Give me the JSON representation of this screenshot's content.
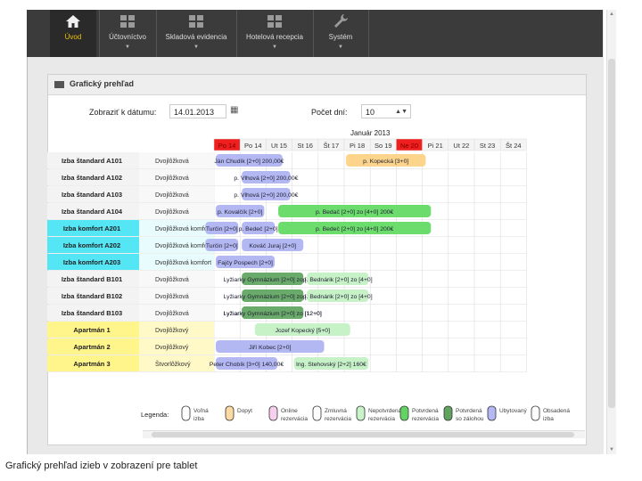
{
  "nav": {
    "items": [
      {
        "label": "Úvod",
        "icon": "home-icon",
        "active": true
      },
      {
        "label": "Účtovníctvo",
        "icon": "grid-icon",
        "active": false
      },
      {
        "label": "Skladová evidencia",
        "icon": "grid-icon",
        "active": false
      },
      {
        "label": "Hotelová recepcia",
        "icon": "grid-icon",
        "active": false
      },
      {
        "label": "Systém",
        "icon": "wrench-icon",
        "active": false
      }
    ]
  },
  "panel": {
    "title": "Grafický prehľad"
  },
  "filters": {
    "date_label": "Zobraziť k dátumu:",
    "date_value": "14.01.2013",
    "days_label": "Počet dní:",
    "days_value": "10"
  },
  "calendar": {
    "month": "Január 2013",
    "days": [
      {
        "label": "Po 14",
        "holiday": true
      },
      {
        "label": "Po 14",
        "holiday": false
      },
      {
        "label": "Ut 15",
        "holiday": false
      },
      {
        "label": "St 16",
        "holiday": false
      },
      {
        "label": "Št 17",
        "holiday": false
      },
      {
        "label": "Pi 18",
        "holiday": false
      },
      {
        "label": "So 19",
        "holiday": false
      },
      {
        "label": "Ne 20",
        "holiday": true
      },
      {
        "label": "Pi 21",
        "holiday": false
      },
      {
        "label": "Ut 22",
        "holiday": false
      },
      {
        "label": "St 23",
        "holiday": false
      },
      {
        "label": "Št 24",
        "holiday": false
      }
    ],
    "rooms": [
      {
        "name": "Izba štandard A101",
        "type": "Dvojlôžková",
        "cat": "std"
      },
      {
        "name": "Izba štandard A102",
        "type": "Dvojlôžková",
        "cat": "std"
      },
      {
        "name": "Izba štandard A103",
        "type": "Dvojlôžková",
        "cat": "std"
      },
      {
        "name": "Izba štandard A104",
        "type": "Dvojlôžková",
        "cat": "std"
      },
      {
        "name": "Izba komfort A201",
        "type": "Dvojlôžková komfort",
        "cat": "kom"
      },
      {
        "name": "Izba komfort A202",
        "type": "Dvojlôžková komfort",
        "cat": "kom"
      },
      {
        "name": "Izba komfort A203",
        "type": "Dvojlôžková komfort",
        "cat": "kom"
      },
      {
        "name": "Izba štandard B101",
        "type": "Dvojlôžková",
        "cat": "std"
      },
      {
        "name": "Izba štandard B102",
        "type": "Dvojlôžková",
        "cat": "std"
      },
      {
        "name": "Izba štandard B103",
        "type": "Dvojlôžková",
        "cat": "std"
      },
      {
        "name": "Apartmán 1",
        "type": "Dvojlôžkový",
        "cat": "apt"
      },
      {
        "name": "Apartmán 2",
        "type": "Dvojlôžkový",
        "cat": "apt"
      },
      {
        "name": "Apartmán 3",
        "type": "Štvorlôžkový",
        "cat": "apt"
      }
    ],
    "bookings": [
      {
        "row": 0,
        "start": 0.0,
        "end": 2.7,
        "status": "ubytovany",
        "label": "Ján Chudík [2+0] 200,00€"
      },
      {
        "row": 0,
        "start": 5.0,
        "end": 8.2,
        "status": "dopyt",
        "label": "p. Kopecká [3+0]"
      },
      {
        "row": 1,
        "start": 1.0,
        "end": 3.0,
        "status": "ubytovany",
        "label": "p. Vlhová [2+0] 200,00€"
      },
      {
        "row": 2,
        "start": 1.0,
        "end": 3.0,
        "status": "ubytovany",
        "label": "p. Vlhová [2+0] 200,00€"
      },
      {
        "row": 3,
        "start": 0.0,
        "end": 2.0,
        "status": "ubytovany",
        "label": "p. Kovalčík [2+0]"
      },
      {
        "row": 3,
        "start": 2.4,
        "end": 8.4,
        "status": "potvrdena",
        "label": "p. Bedač [2+0] zo [4+0] 200€"
      },
      {
        "row": 4,
        "start": -0.4,
        "end": 1.0,
        "status": "ubytovany",
        "label": "Turčin [2+0]"
      },
      {
        "row": 4,
        "start": 1.0,
        "end": 2.4,
        "status": "ubytovany",
        "label": "p. Bedeč [2+0]"
      },
      {
        "row": 4,
        "start": 2.4,
        "end": 8.4,
        "status": "potvrdena",
        "label": "p. Bedeč [2+0] zo [4+0] 200€"
      },
      {
        "row": 5,
        "start": -0.4,
        "end": 1.0,
        "status": "ubytovany",
        "label": "Turčin [2+0]"
      },
      {
        "row": 5,
        "start": 1.0,
        "end": 3.5,
        "status": "ubytovany",
        "label": "Kováč Juraj [2+0]"
      },
      {
        "row": 6,
        "start": 0.0,
        "end": 2.4,
        "status": "ubytovany",
        "label": "Fajčy Pospech [2+0]"
      },
      {
        "row": 7,
        "start": 1.0,
        "end": 3.5,
        "status": "zalohou",
        "label": "Lyžiarky Gymnázium [2+0] zo [12+0]"
      },
      {
        "row": 7,
        "start": 3.5,
        "end": 6.0,
        "status": "nepotvrdena",
        "label": "p. Bednárik [2+0] zo [4+0]"
      },
      {
        "row": 8,
        "start": 1.0,
        "end": 3.5,
        "status": "zalohou",
        "label": "Lyžiarky Gymnázium [2+0] zo [12+0]"
      },
      {
        "row": 8,
        "start": 3.5,
        "end": 6.0,
        "status": "nepotvrdena",
        "label": "p. Bednárik [2+0] zo [4+0]"
      },
      {
        "row": 9,
        "start": 1.0,
        "end": 3.5,
        "status": "zalohou",
        "label": "Lyžiarky Gymnázium [2+0] zo [12+0]"
      },
      {
        "row": 9,
        "start": 1.0,
        "end": 3.5,
        "status": "zalohou",
        "label": "Lyžiarky Gymnázium [2+0] zo [12+0]"
      },
      {
        "row": 10,
        "start": 1.5,
        "end": 5.3,
        "status": "nepotvrdena",
        "label": "Jozef Kopecký [5+0]"
      },
      {
        "row": 11,
        "start": 0.0,
        "end": 4.3,
        "status": "ubytovany",
        "label": "Jiří Kobec [2+0]"
      },
      {
        "row": 12,
        "start": 0.0,
        "end": 2.5,
        "status": "ubytovany",
        "label": "Peter Chobík [3+0] 140,00€"
      },
      {
        "row": 12,
        "start": 3.0,
        "end": 6.0,
        "status": "nepotvrdena",
        "label": "Ing. Stehovský [2+2] 160€"
      }
    ]
  },
  "legend": {
    "title": "Legenda:",
    "items": [
      {
        "label": "Voľná izba",
        "color": "#ffffff"
      },
      {
        "label": "Dopyt",
        "color": "#fdd9a4"
      },
      {
        "label": "Online rezervácia",
        "color": "#f7d0ef"
      },
      {
        "label": "Zmluvná rezervácia",
        "color": "#ffffff"
      },
      {
        "label": "Nepotvrdená rezervácia",
        "color": "#c9f4c9"
      },
      {
        "label": "Potvrdená rezervácia",
        "color": "#63d463"
      },
      {
        "label": "Potvrdená so zálohou",
        "color": "#5fa35f"
      },
      {
        "label": "Ubytovaný",
        "color": "#b3b8f3"
      },
      {
        "label": "Obsadená izba",
        "color": "#ffffff"
      }
    ]
  },
  "colors": {
    "ubytovany": "#b3b8f3",
    "dopyt": "#fcd48b",
    "potvrdena": "#6cdc6c",
    "nepotvrdena": "#c7f2c7",
    "zalohou": "#6aaa6a",
    "std_bg": "#f3f3f3",
    "kom_bg": "#55e6f6",
    "apt_bg": "#fff58a",
    "holiday": "#ef1f1f"
  },
  "caption": "Grafický prehľad izieb v zobrazení pre tablet"
}
